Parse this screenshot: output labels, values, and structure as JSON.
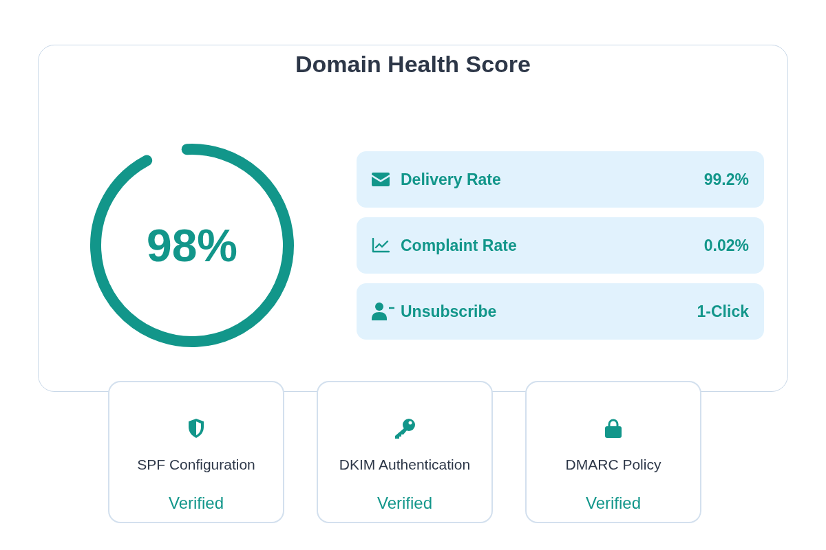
{
  "title": "Domain Health Score",
  "score": {
    "label": "98%",
    "level": 0.93
  },
  "metrics": [
    {
      "label": "Delivery Rate",
      "value": "99.2%"
    },
    {
      "label": "Complaint Rate",
      "value": "0.02%"
    },
    {
      "label": "Unsubscribe",
      "value": "1-Click"
    }
  ],
  "checks": [
    {
      "label": "SPF Configuration",
      "status": "Verified"
    },
    {
      "label": "DKIM Authentication",
      "status": "Verified"
    },
    {
      "label": "DMARC Policy",
      "status": "Verified"
    }
  ]
}
